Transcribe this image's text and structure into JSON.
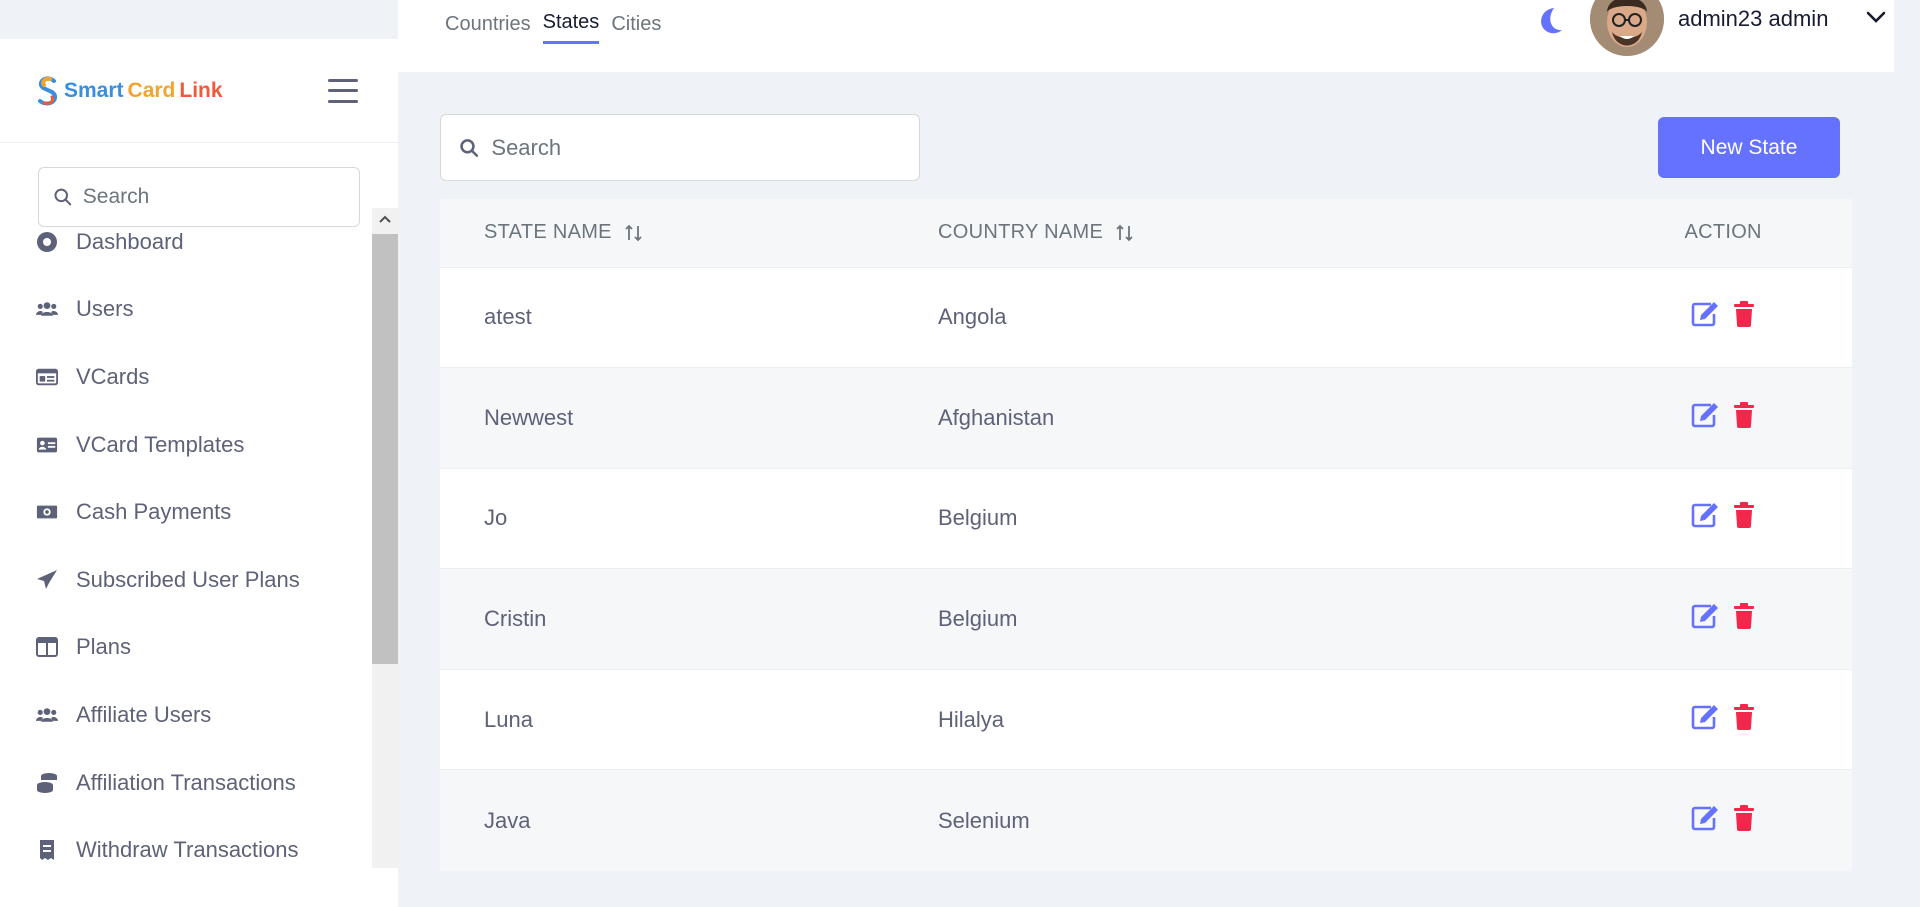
{
  "brand": {
    "smart": "Smart",
    "card": "Card",
    "link": "Link"
  },
  "sidebar": {
    "search_placeholder": "Search",
    "items": [
      {
        "label": "Dashboard",
        "icon": "dashboard-icon"
      },
      {
        "label": "Users",
        "icon": "users-icon"
      },
      {
        "label": "VCards",
        "icon": "vcard-icon"
      },
      {
        "label": "VCard Templates",
        "icon": "template-icon"
      },
      {
        "label": "Cash Payments",
        "icon": "cash-icon"
      },
      {
        "label": "Subscribed User Plans",
        "icon": "paper-plane-icon"
      },
      {
        "label": "Plans",
        "icon": "plans-icon"
      },
      {
        "label": "Affiliate Users",
        "icon": "users-icon"
      },
      {
        "label": "Affiliation Transactions",
        "icon": "coins-icon"
      },
      {
        "label": "Withdraw Transactions",
        "icon": "receipt-icon"
      }
    ]
  },
  "header": {
    "tabs": [
      {
        "label": "Countries",
        "active": false
      },
      {
        "label": "States",
        "active": true
      },
      {
        "label": "Cities",
        "active": false
      }
    ],
    "user_name": "admin23 admin"
  },
  "main": {
    "search_placeholder": "Search",
    "new_button": "New State",
    "columns": {
      "state": "STATE NAME",
      "country": "COUNTRY NAME",
      "action": "ACTION"
    },
    "rows": [
      {
        "state": "atest",
        "country": "Angola"
      },
      {
        "state": "Newwest",
        "country": "Afghanistan"
      },
      {
        "state": "Jo",
        "country": "Belgium"
      },
      {
        "state": "Cristin",
        "country": "Belgium"
      },
      {
        "state": "Luna",
        "country": "Hilalya"
      },
      {
        "state": "Java",
        "country": "Selenium"
      }
    ]
  },
  "colors": {
    "accent": "#6571ff",
    "danger": "#f1284b",
    "text": "#5e6278"
  }
}
